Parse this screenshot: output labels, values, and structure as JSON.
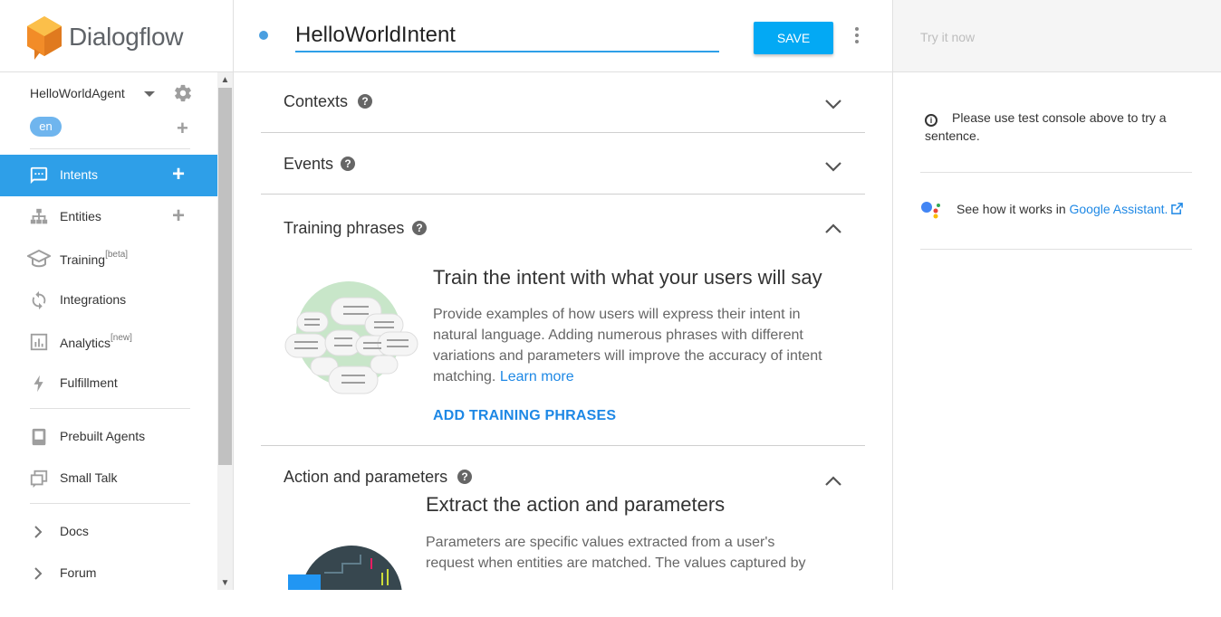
{
  "app": {
    "name": "Dialogflow"
  },
  "sidebar": {
    "agent_name": "HelloWorldAgent",
    "language": "en",
    "items": [
      {
        "label": "Intents",
        "sup": "",
        "icon": "intents-icon",
        "active": true
      },
      {
        "label": "Entities",
        "sup": "",
        "icon": "entities-icon"
      },
      {
        "label": "Training",
        "sup": "[beta]",
        "icon": "training-icon"
      },
      {
        "label": "Integrations",
        "sup": "",
        "icon": "integrations-icon"
      },
      {
        "label": "Analytics",
        "sup": "[new]",
        "icon": "analytics-icon"
      },
      {
        "label": "Fulfillment",
        "sup": "",
        "icon": "fulfillment-icon"
      },
      {
        "label": "Prebuilt Agents",
        "sup": "",
        "icon": "prebuilt-agents-icon"
      },
      {
        "label": "Small Talk",
        "sup": "",
        "icon": "small-talk-icon"
      },
      {
        "label": "Docs",
        "sup": "",
        "icon": "chevron-right-icon"
      },
      {
        "label": "Forum",
        "sup": "",
        "icon": "chevron-right-icon"
      }
    ]
  },
  "header": {
    "intent_name": "HelloWorldIntent",
    "save_label": "SAVE"
  },
  "sections": {
    "contexts": {
      "title": "Contexts",
      "expanded": false
    },
    "events": {
      "title": "Events",
      "expanded": false
    },
    "training": {
      "title": "Training phrases",
      "expanded": true,
      "heading": "Train the intent with what your users will say",
      "body_line1": "Provide examples of how users will express their intent in",
      "body_line2": "natural language. Adding numerous phrases with different",
      "body_line3": "variations and parameters will improve the accuracy of intent",
      "body_line4": "matching.",
      "learn_more": "Learn more",
      "cta": "ADD TRAINING PHRASES"
    },
    "action": {
      "title": "Action and parameters",
      "expanded": true,
      "heading": "Extract the action and parameters",
      "body_line1": "Parameters are specific values extracted from a user's",
      "body_line2": "request when entities are matched. The values captured by"
    }
  },
  "right_panel": {
    "try_placeholder": "Try it now",
    "info_text": "Please use test console above to try a sentence.",
    "assistant_prefix": "See how it works in",
    "assistant_link": "Google Assistant."
  },
  "colors": {
    "accent": "#2e9fe8",
    "save_button": "#03a9f4",
    "link": "#1e88e5",
    "logo_orange": "#f28c28"
  }
}
